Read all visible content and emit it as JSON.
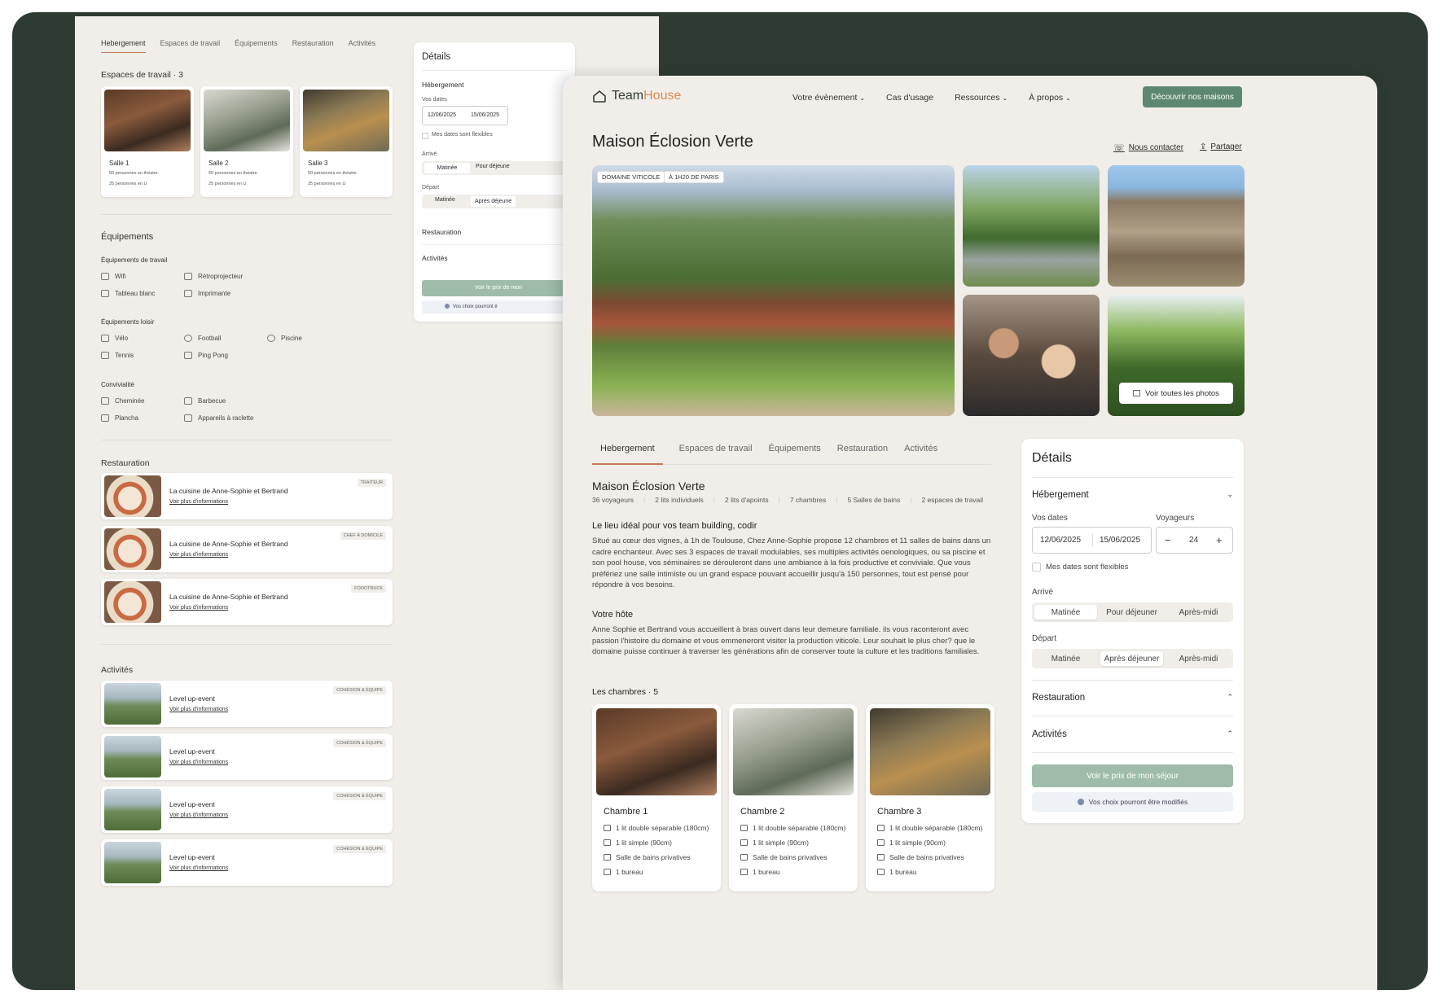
{
  "colors": {
    "frame": "#2e3b33",
    "page_bg": "#f1eee9",
    "accent": "#5d8770",
    "tab_active": "#c77a57",
    "brand_house": "#d98a4e"
  },
  "back": {
    "tabs": [
      "Hebergement",
      "Espaces de travail",
      "Équipements",
      "Restauration",
      "Activités"
    ],
    "workspaces_title": "Espaces de travail · 3",
    "workspaces": [
      {
        "name": "Salle 1",
        "l1": "50 personnes en théatre",
        "l2": "25 personnes en U"
      },
      {
        "name": "Salle 2",
        "l1": "50 personnes en théatre",
        "l2": "25 personnes en U"
      },
      {
        "name": "Salle 3",
        "l1": "50 personnes en théatre",
        "l2": "25 personnes en U"
      }
    ],
    "equip_title": "Équipements",
    "equip_work_title": "Équipements de travail",
    "equip_work": [
      "Wifi",
      "Rétroprojecteur",
      "Tableau blanc",
      "Imprimante"
    ],
    "equip_leisure_title": "Équipements loisir",
    "equip_leisure": [
      "Vélo",
      "Football",
      "Piscine",
      "Tennis",
      "Ping Pong"
    ],
    "conv_title": "Convivialité",
    "conv": [
      "Cheminée",
      "Barbecue",
      "Plancha",
      "Appareils à raclette"
    ],
    "resto_title": "Restauration",
    "resto": [
      {
        "name": "La cuisine de Anne-Sophie et Bertrand",
        "link": "Voir plus d'informations",
        "badge": "TRAITEUR"
      },
      {
        "name": "La cuisine de Anne-Sophie et Bertrand",
        "link": "Voir plus d'informations",
        "badge": "CHEF À DOMICILE"
      },
      {
        "name": "La cuisine de Anne-Sophie et Bertrand",
        "link": "Voir plus d'informations",
        "badge": "FOODTRUCK"
      }
    ],
    "act_title": "Activités",
    "acts": [
      {
        "name": "Level up-event",
        "link": "Voir plus d'informations",
        "badge": "COHÉSION & ÉQUIPE"
      },
      {
        "name": "Level up-event",
        "link": "Voir plus d'informations",
        "badge": "COHÉSION & ÉQUIPE"
      },
      {
        "name": "Level up-event",
        "link": "Voir plus d'informations",
        "badge": "COHÉSION & ÉQUIPE"
      },
      {
        "name": "Level up-event",
        "link": "Voir plus d'informations",
        "badge": "COHÉSION & ÉQUIPE"
      }
    ],
    "details": {
      "title": "Détails",
      "heb": "Hébergement",
      "dates_label": "Vos dates",
      "date_from": "12/06/2025",
      "date_to": "15/06/2025",
      "flex": "Mes dates sont flexibles",
      "arrive": "Arrivé",
      "arr_opts": [
        "Matinée",
        "Pour déjeune"
      ],
      "depart": "Départ",
      "dep_opts": [
        "Matinée",
        "Après déjeune"
      ],
      "resto": "Restauration",
      "acts": "Activités",
      "btn": "Voir le prix de mon",
      "note": "Vos choix pourront ê"
    }
  },
  "front": {
    "logo_team": "Team",
    "logo_house": "House",
    "nav": [
      "Votre évènement",
      "Cas d'usage",
      "Ressources",
      "À propos"
    ],
    "cta": "Découvrir nos maisons",
    "title": "Maison Éclosion Verte",
    "contact": "Nous contacter",
    "share": "Partager",
    "chips": [
      "DOMAINE VITICOLE",
      "À 1H20 DE PARIS"
    ],
    "all_photos": "Voir toutes les photos",
    "tabs": [
      "Hebergement",
      "Espaces de travail",
      "Équipements",
      "Restauration",
      "Activités"
    ],
    "subtitle": "Maison Éclosion Verte",
    "facts": [
      "36 voyageurs",
      "2 lits individuels",
      "2 lits d'apoints",
      "7 chambres",
      "5 Salles de bains",
      "2 espaces de travail"
    ],
    "ideal_title": "Le lieu idéal pour vos team building, codir",
    "ideal_text": "Situé au cœur des vignes, à 1h de Toulouse, Chez Anne-Sophie propose 12 chambres et 11 salles de bains dans un cadre enchanteur. Avec ses 3 espaces de travail modulables, ses multiples activités oenologiques, ou sa piscine et son pool house, vos séminaires se dérouleront dans une ambiance à la fois productive et conviviale. Que vous préfériez une salle intimiste ou un grand espace pouvant accueillir jusqu'à 150 personnes, tout est pensé pour répondre à vos besoins.",
    "host_title": "Votre hôte",
    "host_text": "Anne Sophie et Bertrand vous accueillent à bras ouvert dans leur demeure familiale. ils vous raconteront avec passion l'histoire du domaine et vous emmeneront visiter la production viticole. Leur  souhait le plus cher? que le domaine puisse continuer à traverser les générations afin de conserver toute la culture et les traditions familiales.",
    "rooms_title": "Les chambres · 5",
    "rooms": [
      {
        "name": "Chambre 1",
        "l1": "1 lit double séparable (180cm)",
        "l2": "1 lit simple (90cm)",
        "l3": "Salle de bains privatives",
        "l4": "1 bureau"
      },
      {
        "name": "Chambre 2",
        "l1": "1 lit double séparable (180cm)",
        "l2": "1 lit simple (90cm)",
        "l3": "Salle de bains privatives",
        "l4": "1 bureau"
      },
      {
        "name": "Chambre 3",
        "l1": "1 lit double séparable (180cm)",
        "l2": "1 lit simple (90cm)",
        "l3": "Salle de bains privatives",
        "l4": "1 bureau"
      }
    ],
    "details": {
      "title": "Détails",
      "heb": "Hébergement",
      "dates_label": "Vos dates",
      "voyageurs_label": "Voyageurs",
      "date_from": "12/06/2025",
      "date_to": "15/06/2025",
      "minus": "−",
      "plus": "+",
      "guests": "24",
      "flex": "Mes dates sont flexibles",
      "arrive": "Arrivé",
      "arr_opts": [
        "Matinée",
        "Pour déjeuner",
        "Après-midi"
      ],
      "depart": "Départ",
      "dep_opts": [
        "Matinée",
        "Après déjeuner",
        "Après-midi"
      ],
      "resto": "Restauration",
      "acts": "Activités",
      "btn": "Voir le prix de mon séjour",
      "note": "Vos choix pourront être modifiés"
    }
  }
}
